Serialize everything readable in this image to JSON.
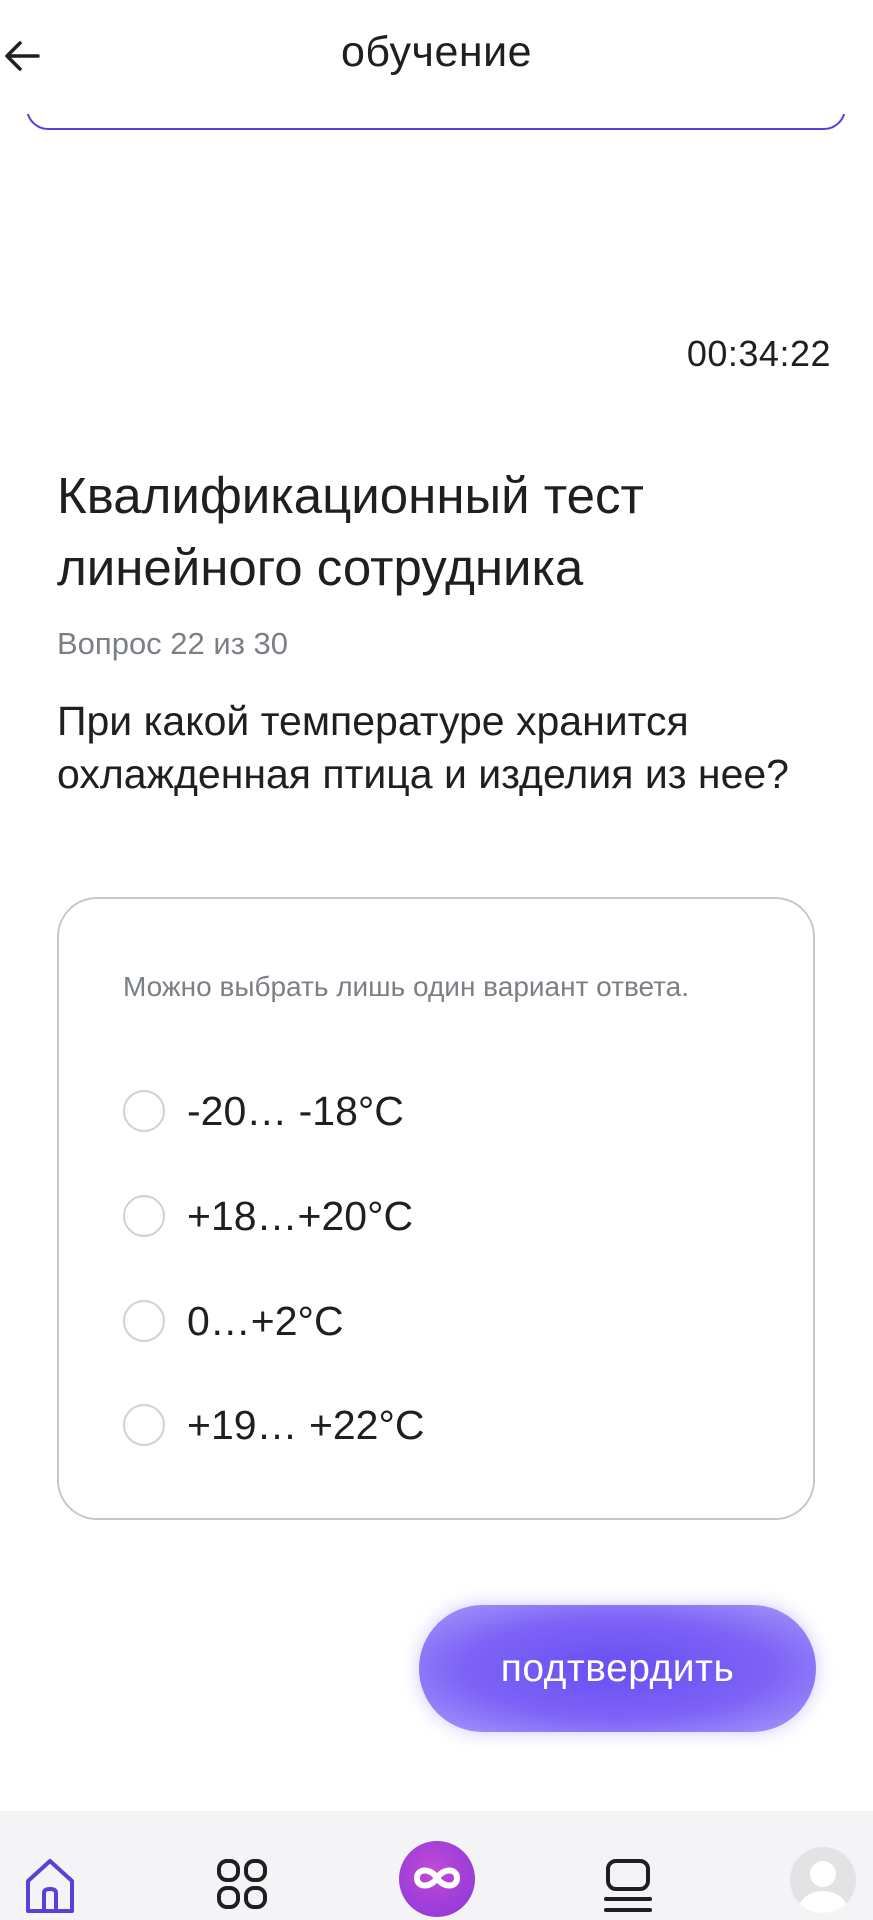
{
  "header": {
    "title": "обучение",
    "back_icon": "arrow-left-icon"
  },
  "timer": "00:34:22",
  "test": {
    "title": "Квалификационный тест линейного сотрудника",
    "counter": "Вопрос 22 из 30",
    "question": "При какой температуре хранится охлажденная птица и изделия из нее?"
  },
  "answers": {
    "hint": "Можно выбрать лишь один вариант ответа.",
    "options": [
      {
        "label": "-20… -18°C",
        "selected": false
      },
      {
        "label": "+18…+20°C",
        "selected": false
      },
      {
        "label": "0…+2°C",
        "selected": false
      },
      {
        "label": "+19… +22°C",
        "selected": false
      }
    ]
  },
  "confirm_button": {
    "label": "подтвердить"
  },
  "bottom_nav": {
    "items": [
      {
        "icon": "home-icon"
      },
      {
        "icon": "grid-icon"
      },
      {
        "icon": "infinity-icon"
      },
      {
        "icon": "feed-icon"
      },
      {
        "icon": "avatar-icon"
      }
    ]
  },
  "colors": {
    "accent": "#6a4ef3",
    "accent_light": "#a999fa",
    "nav_center": "#a43fd8",
    "nav_icon_active": "#5a3fd8",
    "muted_text": "#7b7f86"
  }
}
